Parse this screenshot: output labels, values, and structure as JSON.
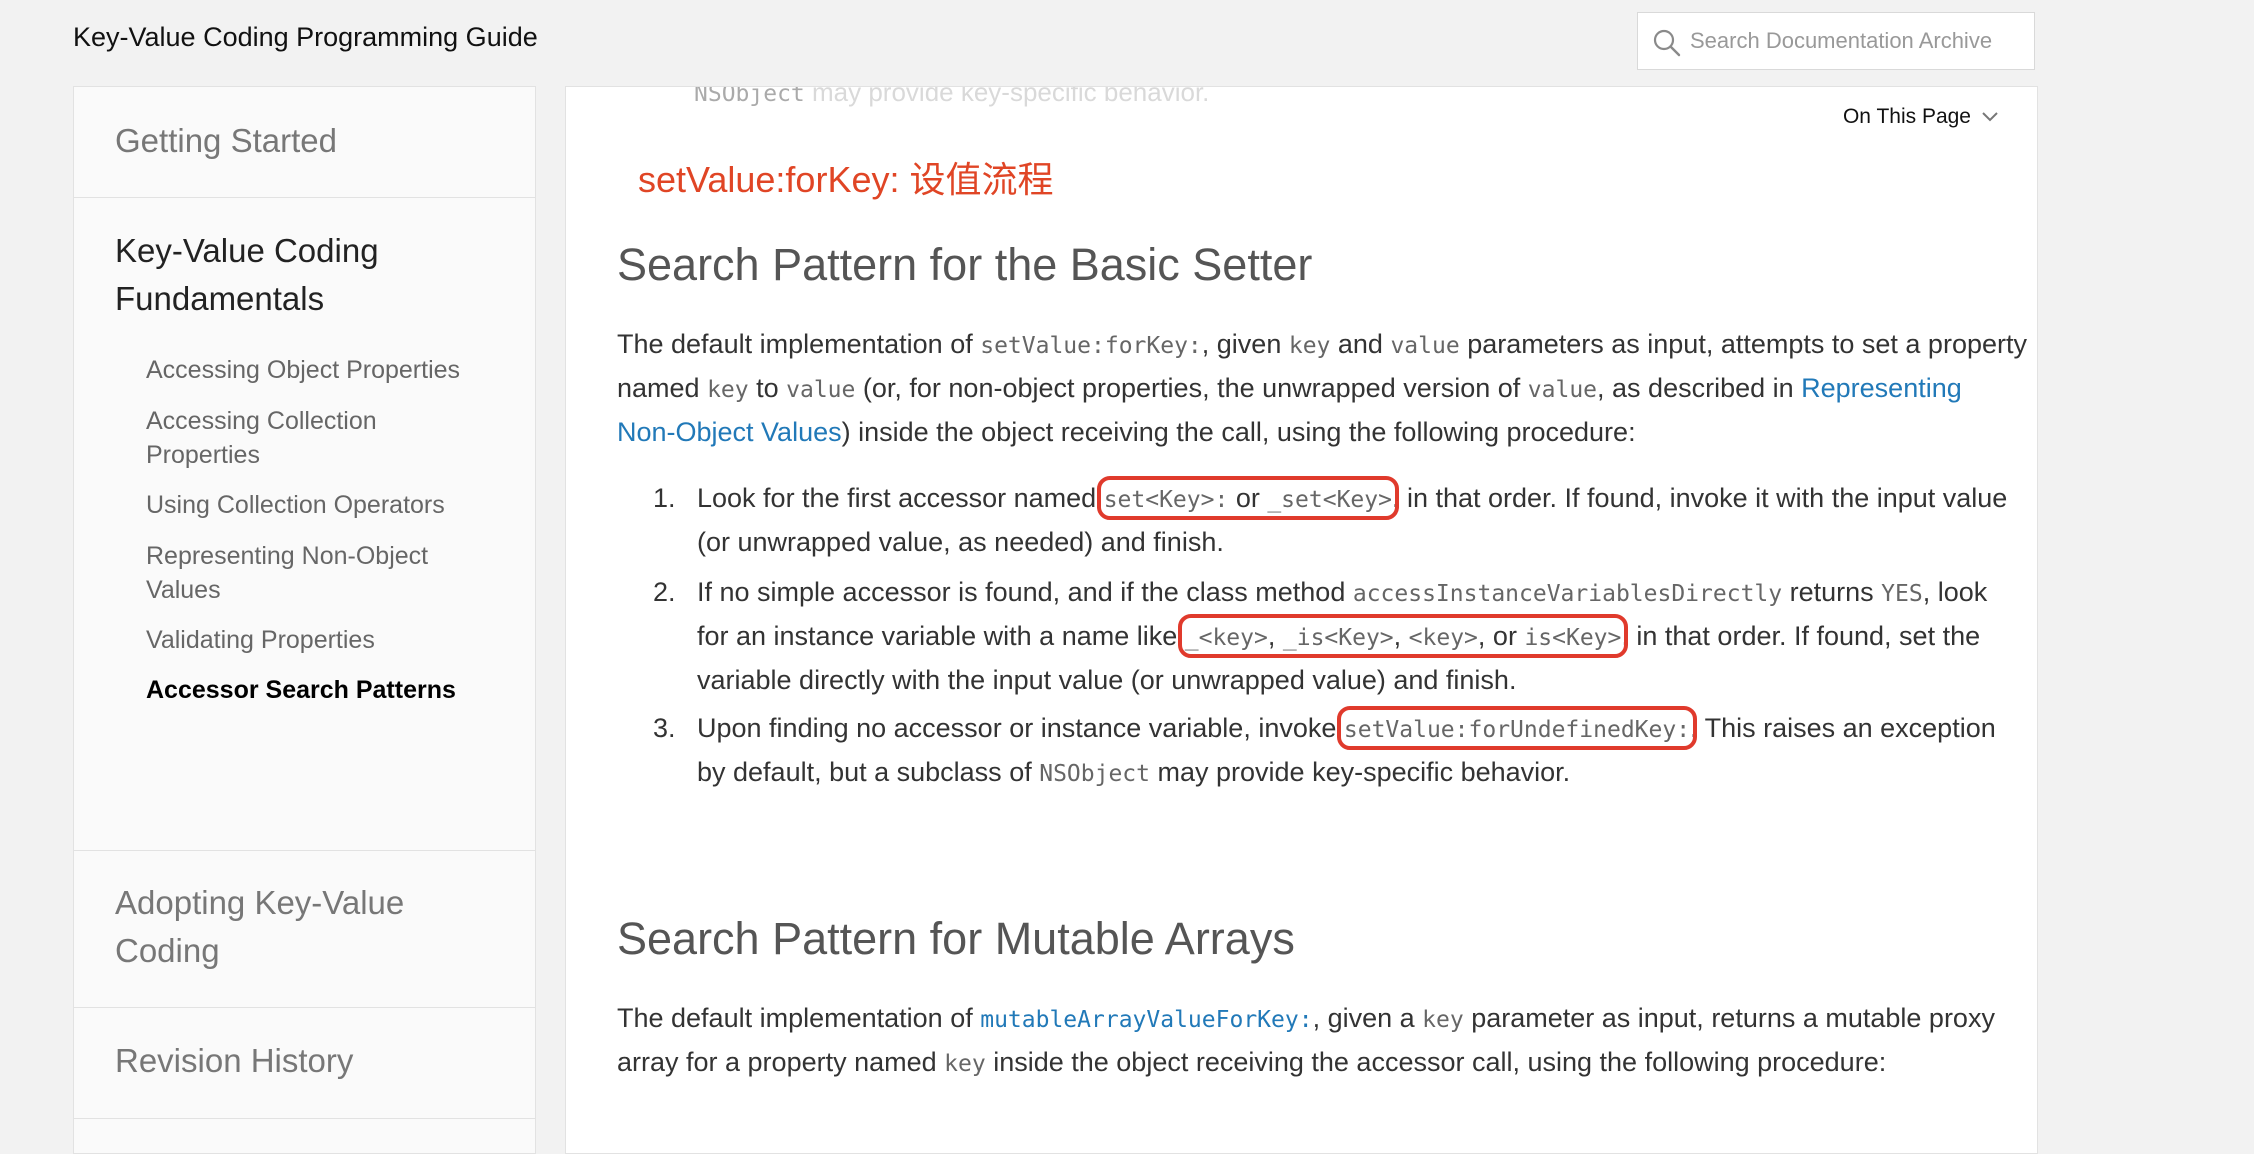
{
  "header": {
    "title": "Key-Value Coding Programming Guide",
    "search_placeholder": "Search Documentation Archive"
  },
  "sidebar": {
    "getting_started": "Getting Started",
    "fundamentals": "Key-Value Coding Fundamentals",
    "subitems": [
      "Accessing Object Properties",
      "Accessing Collection Properties",
      "Using Collection Operators",
      "Representing Non-Object Values",
      "Validating Properties",
      "Accessor Search Patterns"
    ],
    "adopting": "Adopting Key-Value Coding",
    "revision": "Revision History"
  },
  "content": {
    "on_this_page": "On This Page",
    "annotation": "setValue:forKey: 设值流程",
    "section1": {
      "heading": "Search Pattern for the Basic Setter",
      "p_part1": "The default implementation of ",
      "p_code1": "setValue:forKey:",
      "p_part2": ", given ",
      "p_code2": "key",
      "p_part3": " and ",
      "p_code3": "value",
      "p_part4": " parameters as input, attempts to set a property named ",
      "p_code4": "key",
      "p_part5": " to ",
      "p_code5": "value",
      "p_part6": " (or, for non-object properties, the unwrapped version of ",
      "p_code6": "value",
      "p_part7": ", as described in ",
      "p_link": "Representing Non-Object Values",
      "p_part8": ") inside the object receiving the call, using the following procedure:",
      "items": [
        {
          "num": "1.",
          "t1": "Look for the first accessor named ",
          "c1": "set<Key>:",
          "t2": " or ",
          "c2": "_set<Key>",
          "t3": ", in that order. If found, invoke it with the input value (or unwrapped value, as needed) and finish."
        },
        {
          "num": "2.",
          "t1": "If no simple accessor is found, and if the class method ",
          "c1": "accessInstanceVariablesDirectly",
          "t2": " returns ",
          "c2": "YES",
          "t3": ", look for an instance variable with a name like ",
          "c3": "_<key>",
          "t4": ", ",
          "c4": "_is<Key>",
          "t5": ", ",
          "c5": "<key>",
          "t6": ", or ",
          "c6": "is<Key>",
          "t7": ", in that order. If found, set the variable directly with the input value (or unwrapped value) and finish."
        },
        {
          "num": "3.",
          "t1": "Upon finding no accessor or instance variable, invoke ",
          "c1": "setValue:forUndefinedKey:",
          "t2": ". This raises an exception by default, but a subclass of ",
          "c2": "NSObject",
          "t3": " may provide key-specific behavior."
        }
      ]
    },
    "section2": {
      "heading": "Search Pattern for Mutable Arrays",
      "p_part1": "The default implementation of ",
      "p_link_code": "mutableArrayValueForKey:",
      "p_part2": ", given a ",
      "p_code1": "key",
      "p_part3": " parameter as input, returns a mutable proxy array for a property named ",
      "p_code2": "key",
      "p_part4": " inside the object receiving the accessor call, using the following procedure:"
    },
    "faded_top": {
      "code": "NSObject",
      "text": " may provide key-specific behavior."
    }
  }
}
